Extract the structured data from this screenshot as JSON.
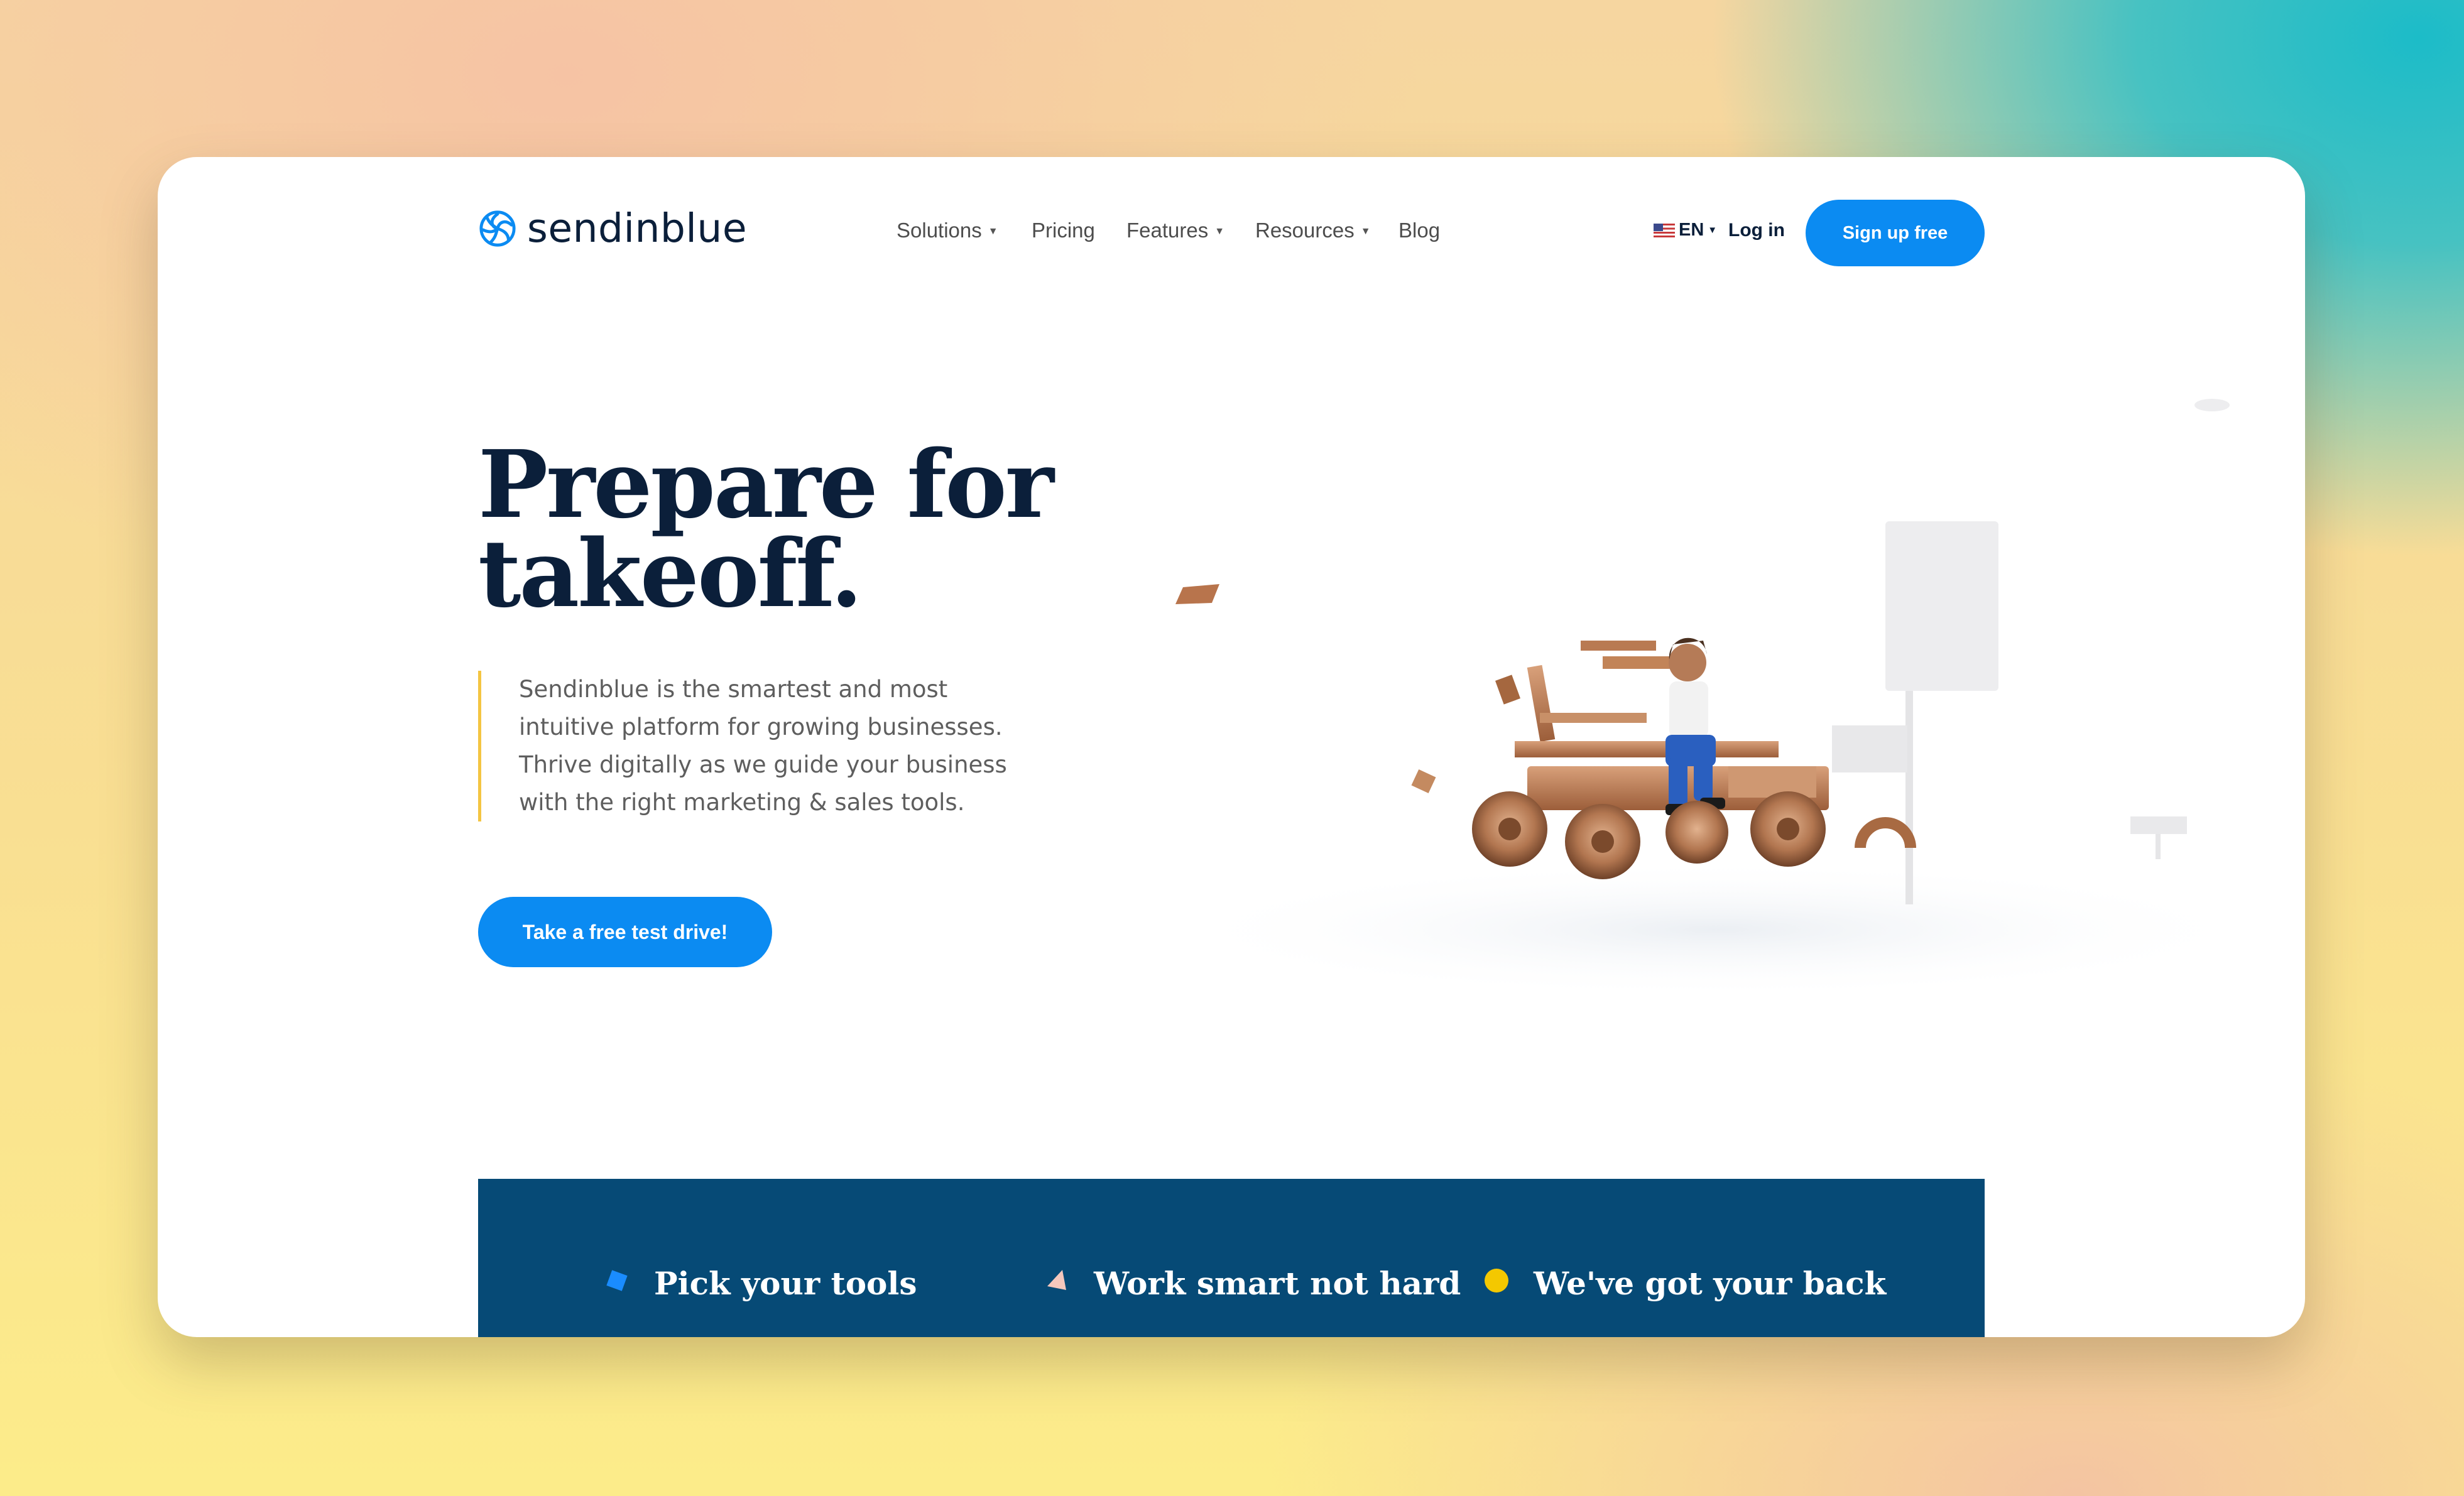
{
  "brand": {
    "name": "sendinblue",
    "accent": "#0b8bf2",
    "navy": "#0b1f3a",
    "band": "#064a76"
  },
  "nav": {
    "items": [
      {
        "label": "Solutions",
        "dropdown": true
      },
      {
        "label": "Pricing",
        "dropdown": false
      },
      {
        "label": "Features",
        "dropdown": true
      },
      {
        "label": "Resources",
        "dropdown": true
      },
      {
        "label": "Blog",
        "dropdown": false
      }
    ],
    "language": "EN",
    "login": "Log in",
    "signup": "Sign up free"
  },
  "hero": {
    "title_line1": "Prepare for",
    "title_line2": "takeoff.",
    "description_lines": [
      "Sendinblue is the smartest and most",
      "intuitive platform for growing businesses.",
      "Thrive digitally as we guide your business",
      "with the right marketing & sales tools."
    ],
    "cta": "Take a free test drive!"
  },
  "features": [
    {
      "title": "Pick your tools",
      "icon": "blue-diamond-icon",
      "color": "#1a8cff"
    },
    {
      "title": "Work smart not hard",
      "icon": "pink-triangle-icon",
      "color": "#f4c7bd"
    },
    {
      "title": "We've got your back",
      "icon": "yellow-circle-icon",
      "color": "#f4c800"
    }
  ]
}
